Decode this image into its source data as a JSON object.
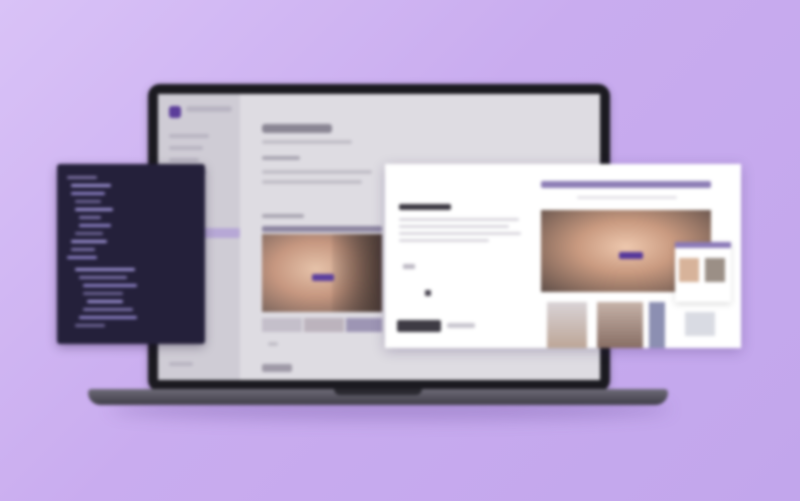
{
  "scene": {
    "background_colors": [
      "#d9c2f7",
      "#c2a6ec"
    ],
    "accent_color": "#5b3d9a"
  },
  "laptop": {
    "app": {
      "sidebar_items_count": 8,
      "active_item_index": 4
    }
  },
  "code_panel": {
    "background_color": "#24203a",
    "lines": 22
  },
  "modal": {
    "primary_button_color": "#3e3b44"
  },
  "gallery": {
    "header_color": "#8d7eb6"
  }
}
